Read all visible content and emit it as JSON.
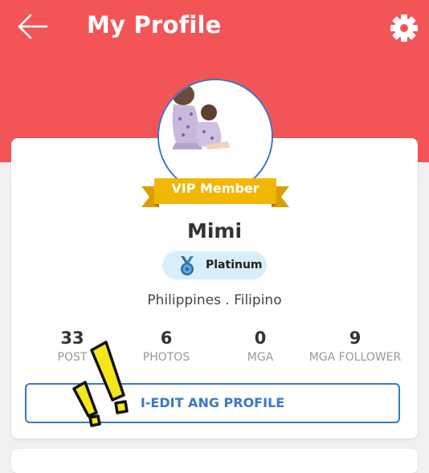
{
  "header": {
    "title": "My Profile",
    "back_icon": "arrow-left-icon",
    "settings_icon": "gear-icon",
    "color": "#f35557"
  },
  "profile": {
    "vip_label": "VIP Member",
    "name": "Mimi",
    "tier": {
      "label": "Platinum",
      "icon": "medal-icon"
    },
    "location": "Philippines . Filipino"
  },
  "stats": [
    {
      "value": "33",
      "label": "POST"
    },
    {
      "value": "6",
      "label": "PHOTOS"
    },
    {
      "value": "0",
      "label": "MGA"
    },
    {
      "value": "9",
      "label": "MGA FOLLOWER"
    }
  ],
  "edit_button": {
    "label": "I-EDIT ANG PROFILE",
    "color": "#3a78c8"
  },
  "colors": {
    "vip_gold": "#f2b705",
    "badge_bg": "#d9eefb"
  }
}
